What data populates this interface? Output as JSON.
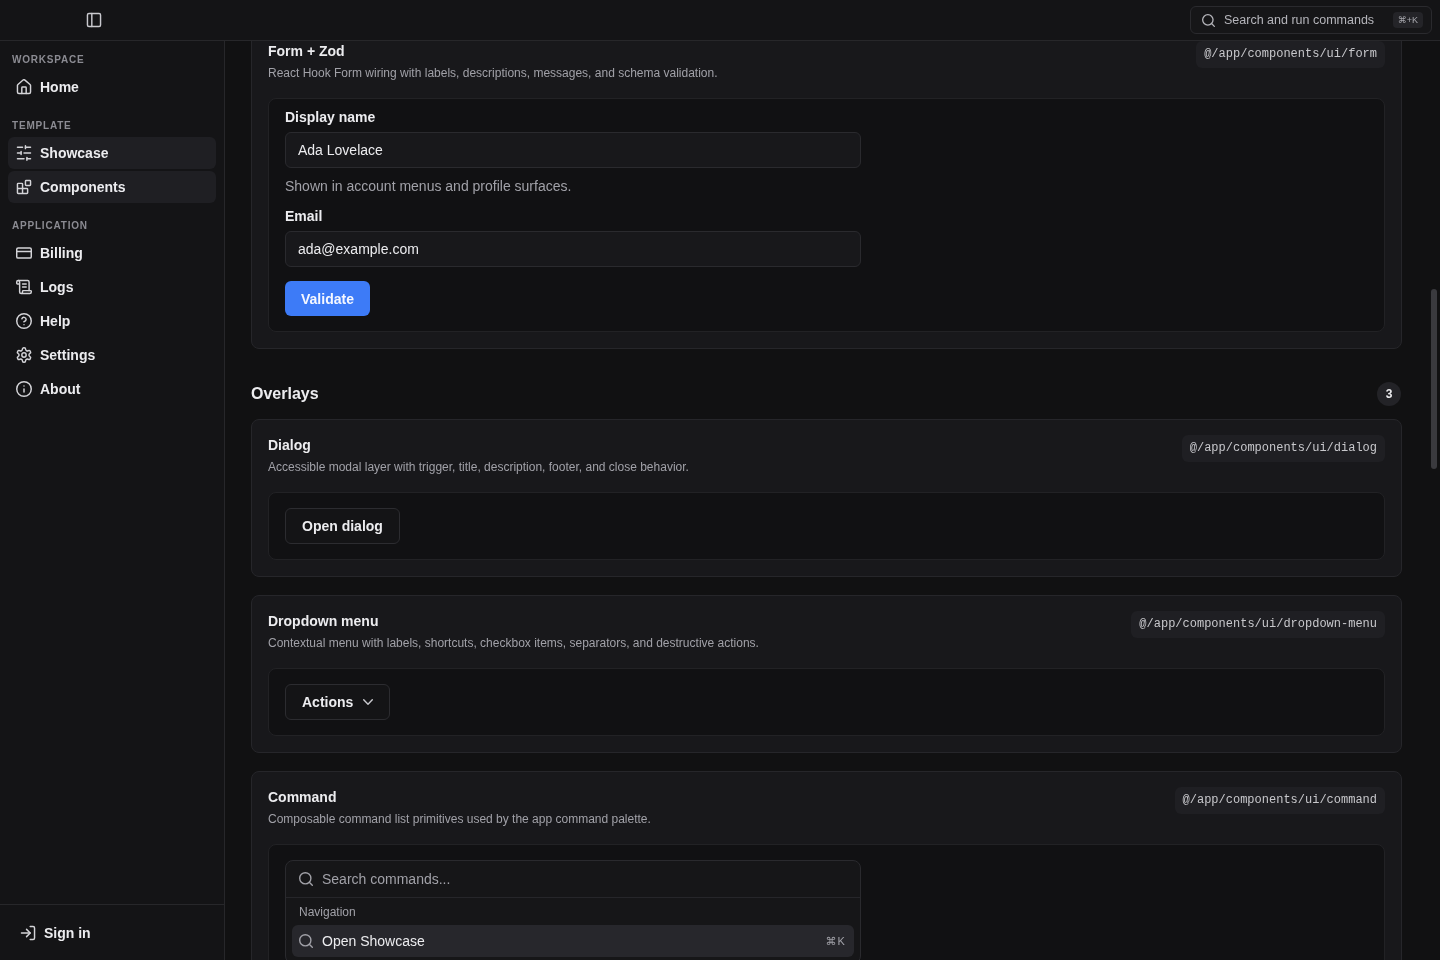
{
  "header": {
    "search": {
      "label": "Search and run commands",
      "shortcut": "⌘+K"
    }
  },
  "sidebar": {
    "groups": [
      {
        "label": "WORKSPACE",
        "items": [
          {
            "label": "Home",
            "selected": false
          }
        ]
      },
      {
        "label": "TEMPLATE",
        "items": [
          {
            "label": "Showcase",
            "selected": true
          },
          {
            "label": "Components",
            "selected": true
          }
        ]
      },
      {
        "label": "APPLICATION",
        "items": [
          {
            "label": "Billing",
            "selected": false
          },
          {
            "label": "Logs",
            "selected": false
          },
          {
            "label": "Help",
            "selected": false
          },
          {
            "label": "Settings",
            "selected": false
          },
          {
            "label": "About",
            "selected": false
          }
        ]
      }
    ],
    "footer": {
      "label": "Sign in"
    }
  },
  "form_card": {
    "kind": "form",
    "title": "Form + Zod",
    "path": "@/app/components/ui/form",
    "description": "React Hook Form wiring with labels, descriptions, messages, and schema validation.",
    "fields": [
      {
        "label": "Display name",
        "value": "Ada Lovelace",
        "description": "Shown in account menus and profile surfaces."
      },
      {
        "label": "Email",
        "value": "ada@example.com"
      }
    ],
    "submit": "Validate"
  },
  "overlays": {
    "title": "Overlays",
    "count": "3",
    "cards": [
      {
        "kind": "dialog",
        "title": "Dialog",
        "path": "@/app/components/ui/dialog",
        "description": "Accessible modal layer with trigger, title, description, footer, and close behavior.",
        "trigger": "Open dialog"
      },
      {
        "kind": "dropdown",
        "title": "Dropdown menu",
        "path": "@/app/components/ui/dropdown-menu",
        "description": "Contextual menu with labels, shortcuts, checkbox items, separators, and destructive actions.",
        "trigger": "Actions"
      },
      {
        "kind": "command",
        "title": "Command",
        "path": "@/app/components/ui/command",
        "description": "Composable command list primitives used by the app command palette.",
        "command": {
          "placeholder": "Search commands...",
          "groups": [
            {
              "heading": "Navigation",
              "items": [
                {
                  "label": "Open Showcase",
                  "shortcut": "⌘K",
                  "selected": true
                }
              ]
            }
          ]
        }
      }
    ]
  }
}
